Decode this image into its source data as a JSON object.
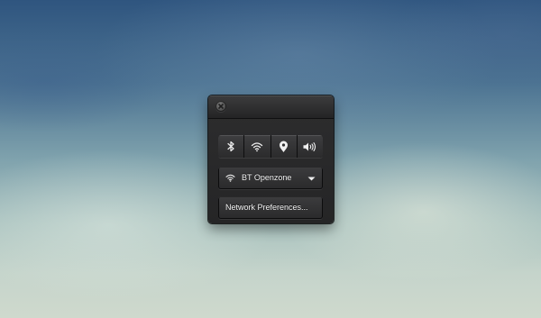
{
  "panel": {
    "close_icon": "close-icon",
    "toggles": [
      {
        "id": "bluetooth",
        "icon": "bluetooth-icon"
      },
      {
        "id": "wifi",
        "icon": "wifi-icon"
      },
      {
        "id": "location",
        "icon": "location-pin-icon"
      },
      {
        "id": "volume",
        "icon": "speaker-volume-icon"
      }
    ],
    "network": {
      "icon": "wifi-signal-icon",
      "selected": "BT Openzone",
      "dropdown_icon": "chevron-down-icon"
    },
    "preferences_label": "Network Preferences..."
  },
  "colors": {
    "panel_bg": "#262627",
    "button_bg": "#343436",
    "text": "#f2f2f2"
  }
}
